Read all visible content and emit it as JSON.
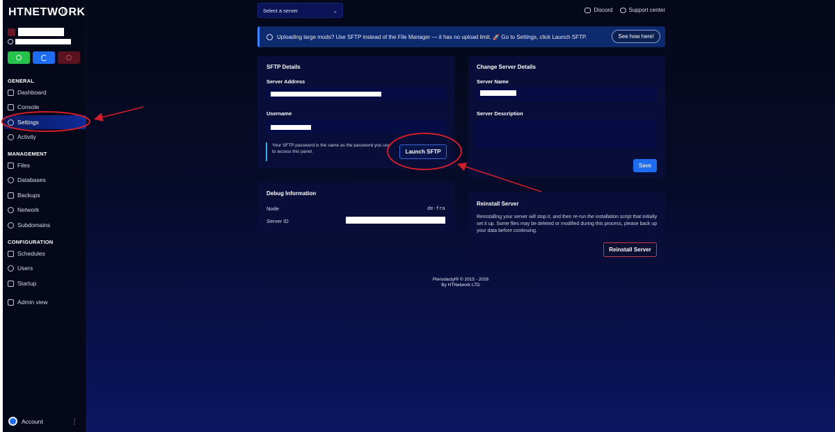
{
  "app": {
    "logo_text": "HTNETW",
    "logo_text_end": "RK"
  },
  "sidebar": {
    "sections": {
      "general": "GENERAL",
      "management": "MANAGEMENT",
      "configuration": "CONFIGURATION"
    },
    "items": {
      "dashboard": "Dashboard",
      "console": "Console",
      "settings": "Settings",
      "activity": "Activity",
      "files": "Files",
      "databases": "Databases",
      "backups": "Backups",
      "network": "Network",
      "subdomains": "Subdomains",
      "schedules": "Schedules",
      "users": "Users",
      "startup": "Startup",
      "admin_view": "Admin view"
    },
    "account_label": "Account",
    "colors": {
      "start": "#27c24c",
      "restart": "#1e6cf0",
      "stop": "#5a1420"
    }
  },
  "topbar": {
    "server_select": "Select a server",
    "discord": "Discord",
    "support": "Support center"
  },
  "banner": {
    "text": "Uploading large mods? Use SFTP instead of the File Manager — it has no upload limit. 🚀 Go to Settings, click Launch SFTP.",
    "button": "See how here!"
  },
  "sftp": {
    "title": "SFTP Details",
    "server_address_label": "Server Address",
    "username_label": "Username",
    "note": "Your SFTP password is the same as the password you use to access this panel.",
    "launch_button": "Launch SFTP"
  },
  "debug": {
    "title": "Debug Information",
    "node_label": "Node",
    "node_value": "de-fra",
    "server_id_label": "Server ID"
  },
  "change_details": {
    "title": "Change Server Details",
    "server_name_label": "Server Name",
    "server_description_label": "Server Description",
    "save_button": "Save"
  },
  "reinstall": {
    "title": "Reinstall Server",
    "description": "Reinstalling your server will stop it, and then re-run the installation script that initially set it up. Some files may be deleted or modified during this process, please back up your data before continuing.",
    "button": "Reinstall Server"
  },
  "footer": {
    "line1": "Pterodactyl® © 2015 - 2026",
    "line2": "By HTNetwork LTD"
  },
  "accent_color": "#1e6cf0",
  "annotation_color": "#d01f2a"
}
